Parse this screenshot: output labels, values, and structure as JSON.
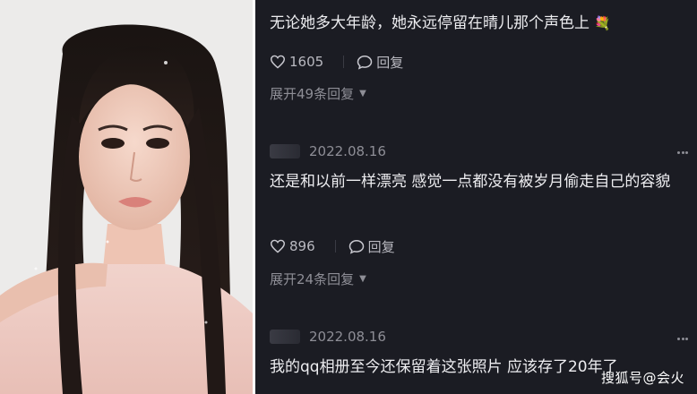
{
  "comments": [
    {
      "text": "无论她多大年龄，她永远停留在晴儿那个声色上",
      "emoji": "💐",
      "likes": "1605",
      "reply_label": "回复",
      "expand_label": "展开49条回复"
    },
    {
      "date": "2022.08.16",
      "text": "还是和以前一样漂亮 感觉一点都没有被岁月偷走自己的容貌",
      "likes": "896",
      "reply_label": "回复",
      "expand_label": "展开24条回复"
    },
    {
      "date": "2022.08.16",
      "text": "我的qq相册至今还保留着这张照片 应该存了20年了"
    }
  ],
  "watermark": "搜狐号@会火",
  "colors": {
    "panel_bg": "#1b1c23",
    "text": "#ededf0",
    "muted": "#8e8e96"
  }
}
